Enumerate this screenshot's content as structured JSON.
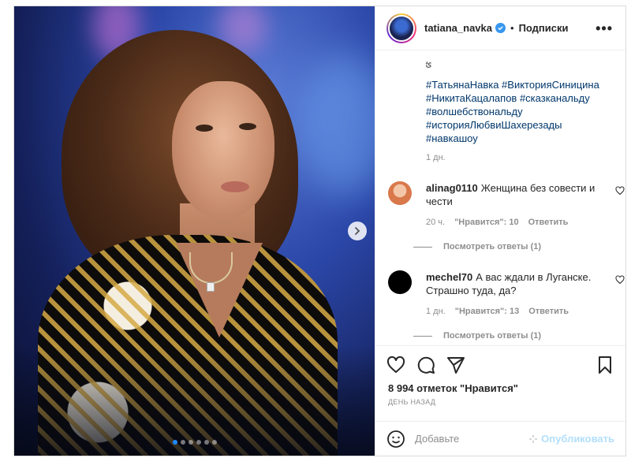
{
  "post": {
    "image_alt": "",
    "carousel": {
      "count": 6,
      "active_index": 0
    }
  },
  "header": {
    "username": "tatiana_navka",
    "verified": true,
    "separator": "•",
    "follow_label": "Подписки",
    "more_label": "•••"
  },
  "caption": {
    "partial_line": "ؿ",
    "hashtags": [
      "#ТатьянаНавка",
      "#ВикторияСиницина",
      "#НикитаКацалапов",
      "#сказканальду",
      "#волшебствональду",
      "#историяЛюбвиШахерезады",
      "#навкашоу"
    ],
    "hashtag_lines": [
      "#ТатьянаНавка #ВикторияСиницина",
      "#НикитаКацалапов #сказканальду",
      "#волшебствональду",
      "#историяЛюбвиШахерезады",
      "#навкашоу"
    ],
    "time": "1 дн."
  },
  "comments": [
    {
      "username": "alinag0110",
      "text": "Женщина без совести и чести",
      "time": "20 ч.",
      "likes": "\"Нравится\": 10",
      "reply_label": "Ответить",
      "view_replies": "Посмотреть ответы (1)",
      "avatar_color": "#e07a4a"
    },
    {
      "username": "mechel70",
      "text": "А вас ждали в Луганске. Страшно туда, да?",
      "time": "1 дн.",
      "likes": "\"Нравится\": 13",
      "reply_label": "Ответить",
      "view_replies": "Посмотреть ответы (1)",
      "avatar_color": "#000000"
    }
  ],
  "actions": {
    "likes_text": "8 994 отметок \"Нравится\"",
    "posted_label": "ДЕНЬ НАЗАД"
  },
  "add_comment": {
    "placeholder": "Добавьте",
    "publish_label": "Опубликовать"
  },
  "colors": {
    "link": "#00376b",
    "muted": "#8e8e8e",
    "verified": "#3897f0",
    "publish_disabled": "#b2dffc",
    "carousel_active": "#1e88ff"
  }
}
